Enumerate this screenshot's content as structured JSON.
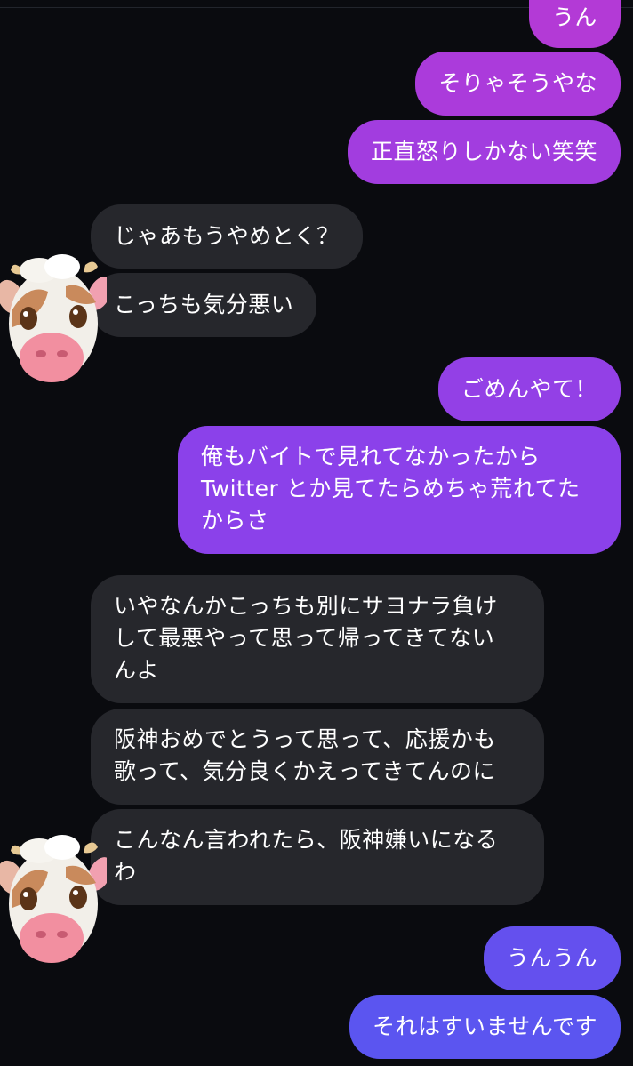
{
  "conversation": {
    "messages": [
      {
        "id": "m1",
        "side": "sent",
        "text": "うん"
      },
      {
        "id": "m2",
        "side": "sent",
        "text": "そりゃそうやな"
      },
      {
        "id": "m3",
        "side": "sent",
        "text": "正直怒りしかない笑笑"
      },
      {
        "id": "m4",
        "side": "received",
        "text": "じゃあもうやめとく？"
      },
      {
        "id": "m5",
        "side": "received",
        "text": "こっちも気分悪い"
      },
      {
        "id": "m6",
        "side": "sent",
        "text": "ごめんやて！"
      },
      {
        "id": "m7",
        "side": "sent",
        "text": "俺もバイトで見れてなかったから\nTwitter とか見てたらめちゃ荒れてた\nからさ"
      },
      {
        "id": "m8",
        "side": "received",
        "text": "いやなんかこっちも別にサヨナラ負け\nして最悪やって思って帰ってきてない\nんよ"
      },
      {
        "id": "m9",
        "side": "received",
        "text": "阪神おめでとうって思って、応援かも\n歌って、気分良くかえってきてんのに"
      },
      {
        "id": "m10",
        "side": "received",
        "text": "こんなん言われたら、阪神嫌いになる\nわ"
      },
      {
        "id": "m11",
        "side": "sent",
        "text": "うんうん"
      },
      {
        "id": "m12",
        "side": "sent",
        "text": "それはすいませんです"
      }
    ],
    "avatar_icon": "cow-memoji-icon"
  },
  "colors": {
    "background": "#0a0b0f",
    "received_bubble": "#26272c",
    "sent_gradient_top": "#b43ad8",
    "sent_gradient_mid": "#8a3cf0",
    "sent_gradient_bottom": "#5b55f0"
  }
}
